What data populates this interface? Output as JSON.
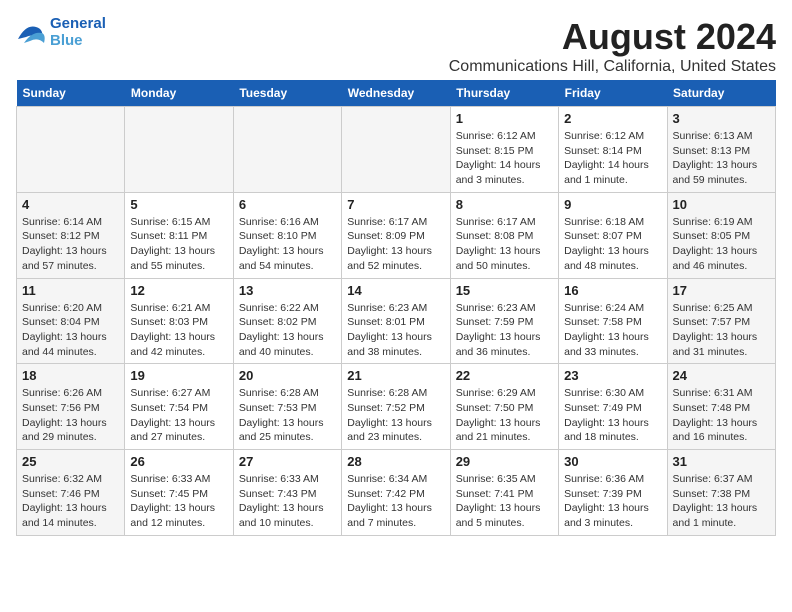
{
  "logo": {
    "name1": "General",
    "name2": "Blue"
  },
  "title": "August 2024",
  "subtitle": "Communications Hill, California, United States",
  "days_of_week": [
    "Sunday",
    "Monday",
    "Tuesday",
    "Wednesday",
    "Thursday",
    "Friday",
    "Saturday"
  ],
  "weeks": [
    [
      {
        "day": "",
        "info": ""
      },
      {
        "day": "",
        "info": ""
      },
      {
        "day": "",
        "info": ""
      },
      {
        "day": "",
        "info": ""
      },
      {
        "day": "1",
        "info": "Sunrise: 6:12 AM\nSunset: 8:15 PM\nDaylight: 14 hours\nand 3 minutes."
      },
      {
        "day": "2",
        "info": "Sunrise: 6:12 AM\nSunset: 8:14 PM\nDaylight: 14 hours\nand 1 minute."
      },
      {
        "day": "3",
        "info": "Sunrise: 6:13 AM\nSunset: 8:13 PM\nDaylight: 13 hours\nand 59 minutes."
      }
    ],
    [
      {
        "day": "4",
        "info": "Sunrise: 6:14 AM\nSunset: 8:12 PM\nDaylight: 13 hours\nand 57 minutes."
      },
      {
        "day": "5",
        "info": "Sunrise: 6:15 AM\nSunset: 8:11 PM\nDaylight: 13 hours\nand 55 minutes."
      },
      {
        "day": "6",
        "info": "Sunrise: 6:16 AM\nSunset: 8:10 PM\nDaylight: 13 hours\nand 54 minutes."
      },
      {
        "day": "7",
        "info": "Sunrise: 6:17 AM\nSunset: 8:09 PM\nDaylight: 13 hours\nand 52 minutes."
      },
      {
        "day": "8",
        "info": "Sunrise: 6:17 AM\nSunset: 8:08 PM\nDaylight: 13 hours\nand 50 minutes."
      },
      {
        "day": "9",
        "info": "Sunrise: 6:18 AM\nSunset: 8:07 PM\nDaylight: 13 hours\nand 48 minutes."
      },
      {
        "day": "10",
        "info": "Sunrise: 6:19 AM\nSunset: 8:05 PM\nDaylight: 13 hours\nand 46 minutes."
      }
    ],
    [
      {
        "day": "11",
        "info": "Sunrise: 6:20 AM\nSunset: 8:04 PM\nDaylight: 13 hours\nand 44 minutes."
      },
      {
        "day": "12",
        "info": "Sunrise: 6:21 AM\nSunset: 8:03 PM\nDaylight: 13 hours\nand 42 minutes."
      },
      {
        "day": "13",
        "info": "Sunrise: 6:22 AM\nSunset: 8:02 PM\nDaylight: 13 hours\nand 40 minutes."
      },
      {
        "day": "14",
        "info": "Sunrise: 6:23 AM\nSunset: 8:01 PM\nDaylight: 13 hours\nand 38 minutes."
      },
      {
        "day": "15",
        "info": "Sunrise: 6:23 AM\nSunset: 7:59 PM\nDaylight: 13 hours\nand 36 minutes."
      },
      {
        "day": "16",
        "info": "Sunrise: 6:24 AM\nSunset: 7:58 PM\nDaylight: 13 hours\nand 33 minutes."
      },
      {
        "day": "17",
        "info": "Sunrise: 6:25 AM\nSunset: 7:57 PM\nDaylight: 13 hours\nand 31 minutes."
      }
    ],
    [
      {
        "day": "18",
        "info": "Sunrise: 6:26 AM\nSunset: 7:56 PM\nDaylight: 13 hours\nand 29 minutes."
      },
      {
        "day": "19",
        "info": "Sunrise: 6:27 AM\nSunset: 7:54 PM\nDaylight: 13 hours\nand 27 minutes."
      },
      {
        "day": "20",
        "info": "Sunrise: 6:28 AM\nSunset: 7:53 PM\nDaylight: 13 hours\nand 25 minutes."
      },
      {
        "day": "21",
        "info": "Sunrise: 6:28 AM\nSunset: 7:52 PM\nDaylight: 13 hours\nand 23 minutes."
      },
      {
        "day": "22",
        "info": "Sunrise: 6:29 AM\nSunset: 7:50 PM\nDaylight: 13 hours\nand 21 minutes."
      },
      {
        "day": "23",
        "info": "Sunrise: 6:30 AM\nSunset: 7:49 PM\nDaylight: 13 hours\nand 18 minutes."
      },
      {
        "day": "24",
        "info": "Sunrise: 6:31 AM\nSunset: 7:48 PM\nDaylight: 13 hours\nand 16 minutes."
      }
    ],
    [
      {
        "day": "25",
        "info": "Sunrise: 6:32 AM\nSunset: 7:46 PM\nDaylight: 13 hours\nand 14 minutes."
      },
      {
        "day": "26",
        "info": "Sunrise: 6:33 AM\nSunset: 7:45 PM\nDaylight: 13 hours\nand 12 minutes."
      },
      {
        "day": "27",
        "info": "Sunrise: 6:33 AM\nSunset: 7:43 PM\nDaylight: 13 hours\nand 10 minutes."
      },
      {
        "day": "28",
        "info": "Sunrise: 6:34 AM\nSunset: 7:42 PM\nDaylight: 13 hours\nand 7 minutes."
      },
      {
        "day": "29",
        "info": "Sunrise: 6:35 AM\nSunset: 7:41 PM\nDaylight: 13 hours\nand 5 minutes."
      },
      {
        "day": "30",
        "info": "Sunrise: 6:36 AM\nSunset: 7:39 PM\nDaylight: 13 hours\nand 3 minutes."
      },
      {
        "day": "31",
        "info": "Sunrise: 6:37 AM\nSunset: 7:38 PM\nDaylight: 13 hours\nand 1 minute."
      }
    ]
  ]
}
